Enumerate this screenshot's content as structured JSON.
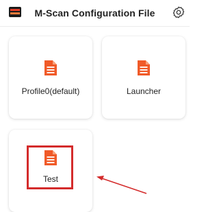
{
  "header": {
    "title": "M-Scan Configuration File",
    "logo_icon": "app-logo-icon",
    "settings_icon": "gear-icon"
  },
  "cards": [
    {
      "label": "Profile0(default)",
      "icon": "document-icon"
    },
    {
      "label": "Launcher",
      "icon": "document-icon"
    },
    {
      "label": "Test",
      "icon": "document-icon",
      "highlighted": true
    }
  ],
  "annotation": {
    "highlight_color": "#d42b2b",
    "arrow_color": "#d42b2b"
  },
  "colors": {
    "icon_accent": "#f05a28",
    "text": "#222222"
  }
}
